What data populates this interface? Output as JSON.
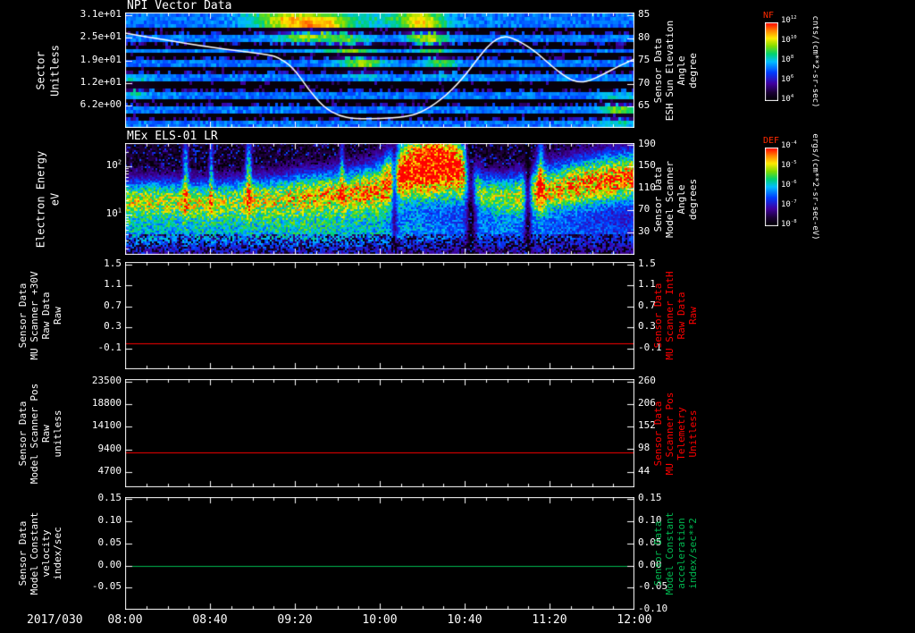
{
  "figure": {
    "background": "#000000",
    "text_color": "#ffffff",
    "accent_red": "#ff0000",
    "accent_green": "#00b850"
  },
  "x_axis": {
    "date_label": "2017/030",
    "tick_labels": [
      "08:00",
      "08:40",
      "09:20",
      "10:00",
      "10:40",
      "11:20",
      "12:00"
    ],
    "minor_per_major": 4
  },
  "chart_data": [
    {
      "id": "npi",
      "type": "heatmap",
      "title": "NPI Vector Data",
      "ylabel_lines": [
        "Sector",
        "Unitless"
      ],
      "scale": "linear",
      "ylim": [
        0,
        32.2
      ],
      "ytick_values": [
        31.4,
        25.1,
        18.8,
        12.6,
        6.28
      ],
      "ytick_labels": [
        "3.1e+01",
        "2.5e+01",
        "1.9e+01",
        "1.2e+01",
        "6.2e+00"
      ],
      "right_axis": {
        "label_lines": [
          "Sensor Data",
          "ESH Sun Elevation",
          "Angle",
          "degree"
        ],
        "color": "#ffffff",
        "lim": [
          60.3,
          85.6
        ],
        "tick_values": [
          85,
          80,
          75,
          70,
          65
        ],
        "tick_labels": [
          "85",
          "80",
          "75",
          "70",
          "65"
        ]
      },
      "overlay_line": {
        "name": "esh-sun-elevation-angle",
        "color": "#ffffff",
        "axis": "right",
        "points_x": [
          0,
          0.05,
          0.1,
          0.15,
          0.2,
          0.25,
          0.28,
          0.3,
          0.33,
          0.36,
          0.39,
          0.42,
          0.45,
          0.5,
          0.55,
          0.58,
          0.62,
          0.66,
          0.7,
          0.72,
          0.74,
          0.76,
          0.8,
          0.84,
          0.87,
          0.89,
          0.91,
          0.94,
          0.97,
          1.0
        ],
        "points_y": [
          81.1,
          80.1,
          79.2,
          78.3,
          77.5,
          76.8,
          76.4,
          75.8,
          73.6,
          68.7,
          64.8,
          62.9,
          62.3,
          62.3,
          62.7,
          63.6,
          66.4,
          70.7,
          76.6,
          79.1,
          80.4,
          80.1,
          77.6,
          73.6,
          71.1,
          70.3,
          70.5,
          72.1,
          73.9,
          75.4
        ]
      },
      "heatmap": {
        "rows": 32,
        "row_shade": [
          "b",
          "b",
          "b",
          "b",
          "k",
          "s",
          "b",
          "b",
          "s",
          "k",
          "b",
          "k",
          "s",
          "b",
          "b",
          "k",
          "s",
          "b",
          "b",
          "k",
          "k",
          "s",
          "b",
          "b",
          "k",
          "s",
          "b",
          "b",
          "k",
          "s",
          "b",
          "b"
        ],
        "blobs": [
          {
            "x": 0.31,
            "row": 1,
            "rx": 0.045,
            "ry": 2.2,
            "a": 0.28
          },
          {
            "x": 0.35,
            "row": 5,
            "rx": 0.035,
            "ry": 2.5,
            "a": 0.3
          },
          {
            "x": 0.4,
            "row": 3,
            "rx": 0.03,
            "ry": 2.0,
            "a": 0.22
          },
          {
            "x": 0.44,
            "row": 9,
            "rx": 0.03,
            "ry": 2.5,
            "a": 0.3
          },
          {
            "x": 0.58,
            "row": 2,
            "rx": 0.03,
            "ry": 3.0,
            "a": 0.33
          },
          {
            "x": 0.6,
            "row": 8,
            "rx": 0.025,
            "ry": 2.5,
            "a": 0.28
          },
          {
            "x": 0.47,
            "row": 14,
            "rx": 0.028,
            "ry": 2.2,
            "a": 0.26
          },
          {
            "x": 0.62,
            "row": 14,
            "rx": 0.022,
            "ry": 2.0,
            "a": 0.22
          },
          {
            "x": 0.97,
            "row": 27,
            "rx": 0.03,
            "ry": 3.0,
            "a": 0.25
          },
          {
            "x": 0.02,
            "row": 20,
            "rx": 0.025,
            "ry": 2.0,
            "a": 0.2
          },
          {
            "x": 0.45,
            "row": 1,
            "rx": 0.12,
            "ry": 2.0,
            "a": 0.15
          }
        ]
      },
      "colorbar": {
        "title": "NF",
        "units": "cnts/(cm**2-sr-sec)",
        "tick_labels": [
          "10^12",
          "10^10",
          "10^8",
          "10^6",
          "10^4"
        ]
      }
    },
    {
      "id": "els",
      "type": "heatmap",
      "title": "MEx ELS-01 LR",
      "ylabel_lines": [
        "Electron Energy",
        "eV"
      ],
      "scale": "log",
      "ylim": [
        1.5,
        300
      ],
      "ytick_values": [
        100,
        10
      ],
      "ytick_labels": [
        "10^2",
        "10^1"
      ],
      "right_axis": {
        "label_lines": [
          "Sensor Data",
          "Model Scanner",
          "Angle",
          "degrees"
        ],
        "color": "#ffffff",
        "lim": [
          -11,
          193
        ],
        "tick_values": [
          190,
          150,
          110,
          70,
          30
        ],
        "tick_labels": [
          "190",
          "150",
          "110",
          "70",
          "30"
        ]
      },
      "spectrogram": {
        "x_samples": [
          0,
          0.05,
          0.1,
          0.15,
          0.2,
          0.25,
          0.3,
          0.35,
          0.4,
          0.45,
          0.5,
          0.55,
          0.6,
          0.65,
          0.7,
          0.75,
          0.8,
          0.85,
          0.9,
          0.95,
          1
        ],
        "band_center_log10ev": [
          1.3,
          1.31,
          1.3,
          1.29,
          1.3,
          1.32,
          1.34,
          1.38,
          1.41,
          1.44,
          1.52,
          1.9,
          2.05,
          1.98,
          1.42,
          1.36,
          1.45,
          1.55,
          1.64,
          1.72,
          1.78
        ],
        "band_amplitude": [
          0.62,
          0.63,
          0.61,
          0.62,
          0.6,
          0.63,
          0.65,
          0.7,
          0.72,
          0.74,
          0.78,
          0.96,
          1.05,
          0.98,
          0.55,
          0.6,
          0.68,
          0.75,
          0.8,
          0.82,
          0.82
        ],
        "band_width_log": [
          0.28,
          0.28,
          0.28,
          0.28,
          0.29,
          0.3,
          0.31,
          0.33,
          0.33,
          0.34,
          0.38,
          0.5,
          0.55,
          0.5,
          0.3,
          0.31,
          0.33,
          0.35,
          0.36,
          0.36,
          0.36
        ],
        "low_glow_amplitude": [
          0.36,
          0.37,
          0.36,
          0.37,
          0.35,
          0.37,
          0.38,
          0.4,
          0.38,
          0.37,
          0.34,
          0.32,
          0.3,
          0.27,
          0.29,
          0.28,
          0.27,
          0.26,
          0.25,
          0.24,
          0.24
        ],
        "spikes": [
          {
            "x": 0.118,
            "w": 0.004,
            "a": 0.4
          },
          {
            "x": 0.168,
            "w": 0.003,
            "a": 0.35
          },
          {
            "x": 0.242,
            "w": 0.0045,
            "a": 0.42
          },
          {
            "x": 0.425,
            "w": 0.003,
            "a": 0.3
          },
          {
            "x": 0.815,
            "w": 0.005,
            "a": 0.4
          }
        ],
        "gaps": [
          {
            "x": 0.528,
            "w": 0.004,
            "f": 0.45
          },
          {
            "x": 0.678,
            "w": 0.007,
            "f": 0.22
          },
          {
            "x": 0.79,
            "w": 0.005,
            "f": 0.28
          }
        ]
      },
      "colorbar": {
        "title": "DEF",
        "units": "ergs/(cm**2-sr-sec-eV)",
        "tick_labels": [
          "10^-4",
          "10^-5",
          "10^-6",
          "10^-7",
          "10^-8"
        ]
      }
    },
    {
      "id": "mu30v",
      "type": "line",
      "ylabel_lines": [
        "Sensor Data",
        "MU Scanner +30V",
        "Raw Data",
        "Raw"
      ],
      "scale": "linear",
      "ylim": [
        -0.5,
        1.55
      ],
      "ytick_values": [
        1.5,
        1.1,
        0.7,
        0.3,
        -0.1
      ],
      "ytick_labels": [
        "1.5",
        "1.1",
        "0.7",
        "0.3",
        "-0.1"
      ],
      "right_axis": {
        "label_lines": [
          "Sensor Data",
          "MU Scanner IntH",
          "Raw Data",
          "Raw"
        ],
        "color": "#ff0000",
        "lim": [
          -0.5,
          1.55
        ],
        "tick_values": [
          1.5,
          1.1,
          0.7,
          0.3,
          -0.1
        ],
        "tick_labels": [
          "1.5",
          "1.1",
          "0.7",
          "0.3",
          "-0.1"
        ]
      },
      "series": [
        {
          "name": "mu-scanner-30v-raw",
          "color": "#ff0000",
          "constant_value": 0.0
        }
      ]
    },
    {
      "id": "scanpos",
      "type": "line",
      "ylabel_lines": [
        "Sensor Data",
        "Model Scanner Pos",
        "Raw",
        "unitless"
      ],
      "scale": "linear",
      "ylim": [
        1500,
        24000
      ],
      "ytick_values": [
        23500,
        18800,
        14100,
        9400,
        4700
      ],
      "ytick_labels": [
        "23500",
        "18800",
        "14100",
        "9400",
        "4700"
      ],
      "right_axis": {
        "label_lines": [
          "Sensor Data",
          "MU Scanner Pos",
          "Telemetry",
          "Unitless"
        ],
        "color": "#ff0000",
        "lim": [
          7,
          266
        ],
        "tick_values": [
          260,
          206,
          152,
          98,
          44
        ],
        "tick_labels": [
          "260",
          "206",
          "152",
          "98",
          "44"
        ]
      },
      "series": [
        {
          "name": "model-scanner-pos-raw",
          "color": "#ff0000",
          "constant_value": 8750
        }
      ]
    },
    {
      "id": "modelconst",
      "type": "line",
      "ylabel_lines": [
        "Sensor Data",
        "Model Constant",
        "velocity",
        "index/sec"
      ],
      "scale": "linear",
      "ylim": [
        -0.1,
        0.155
      ],
      "ytick_values": [
        0.15,
        0.1,
        0.05,
        0.0,
        -0.05
      ],
      "ytick_labels": [
        "0.15",
        "0.10",
        "0.05",
        "0.00",
        "-0.05"
      ],
      "right_axis": {
        "label_lines": [
          "Sensor Data",
          "Model Constant",
          "acceleration",
          "index/sec**2"
        ],
        "color": "#00b850",
        "lim": [
          -0.1,
          0.155
        ],
        "tick_values": [
          0.15,
          0.1,
          0.05,
          0.0,
          -0.05,
          -0.1
        ],
        "tick_labels": [
          "0.15",
          "0.10",
          "0.05",
          "0.00",
          "-0.05",
          "-0.10"
        ]
      },
      "series": [
        {
          "name": "model-constant-velocity",
          "color": "#00b850",
          "constant_value": 0.0
        }
      ]
    }
  ]
}
